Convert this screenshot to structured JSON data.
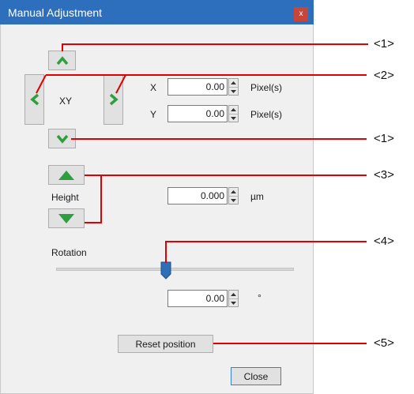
{
  "window": {
    "title": "Manual Adjustment",
    "close_glyph": "x"
  },
  "xy": {
    "label": "XY",
    "x": {
      "axis": "X",
      "value": "0.00",
      "unit": "Pixel(s)"
    },
    "y": {
      "axis": "Y",
      "value": "0.00",
      "unit": "Pixel(s)"
    }
  },
  "height": {
    "label": "Height",
    "value": "0.000",
    "unit": "µm"
  },
  "rotation": {
    "label": "Rotation",
    "value": "0.00",
    "unit": "°",
    "slider_position": 0.5
  },
  "buttons": {
    "reset": "Reset position",
    "close": "Close"
  },
  "callouts": [
    "<1>",
    "<2>",
    "<1>",
    "<3>",
    "<4>",
    "<5>"
  ],
  "colors": {
    "titlebar": "#2d6ebd",
    "arrow_green": "#2e9e3e",
    "callout_red": "#e00000",
    "slider_thumb": "#2f6fb8"
  }
}
